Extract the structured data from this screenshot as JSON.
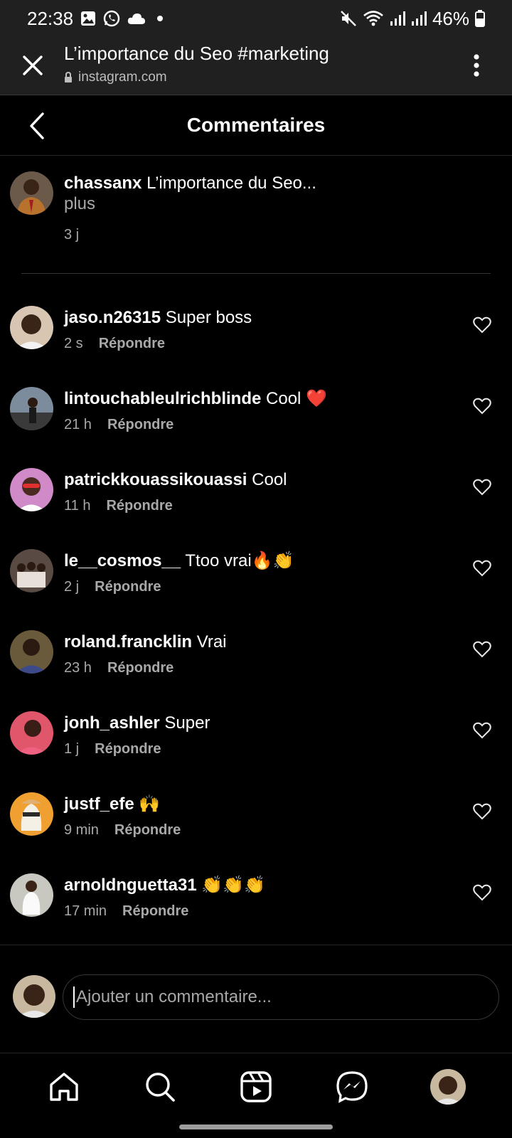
{
  "status_bar": {
    "time": "22:38",
    "battery": "46%"
  },
  "browser": {
    "title": "L’importance du Seo #marketing",
    "url": "instagram.com"
  },
  "header": {
    "title": "Commentaires"
  },
  "caption": {
    "username": "chassanx",
    "text": "L’importance du Seo...",
    "more": "plus",
    "time": "3 j"
  },
  "comments": [
    {
      "username": "jaso.n26315",
      "text": "Super boss",
      "time": "2 s",
      "reply": "Répondre",
      "avatar_color": "#d8c6b2"
    },
    {
      "username": "lintouchableulrichblinde",
      "text": "Cool ❤️",
      "time": "21 h",
      "reply": "Répondre",
      "avatar_color": "#7c8c9c"
    },
    {
      "username": "patrickkouassikouassi",
      "text": "Cool",
      "time": "11 h",
      "reply": "Répondre",
      "avatar_color": "#d08ac8"
    },
    {
      "username": "le__cosmos__",
      "text": "Ttoo vrai🔥👏",
      "time": "2 j",
      "reply": "Répondre",
      "avatar_color": "#5a4a44"
    },
    {
      "username": "roland.francklin",
      "text": "Vrai",
      "time": "23 h",
      "reply": "Répondre",
      "avatar_color": "#6a5a3c"
    },
    {
      "username": "jonh_ashler",
      "text": "Super",
      "time": "1 j",
      "reply": "Répondre",
      "avatar_color": "#e0566a"
    },
    {
      "username": "justf_efe",
      "text": "🙌",
      "time": "9 min",
      "reply": "Répondre",
      "avatar_color": "#f0a030"
    },
    {
      "username": "arnoldnguetta31",
      "text": "👏👏👏",
      "time": "17 min",
      "reply": "Répondre",
      "avatar_color": "#c8c8c0"
    }
  ],
  "input": {
    "placeholder": "Ajouter un commentaire..."
  },
  "nav": [
    "home-icon",
    "search-icon",
    "reels-icon",
    "messenger-icon",
    "profile-avatar"
  ]
}
